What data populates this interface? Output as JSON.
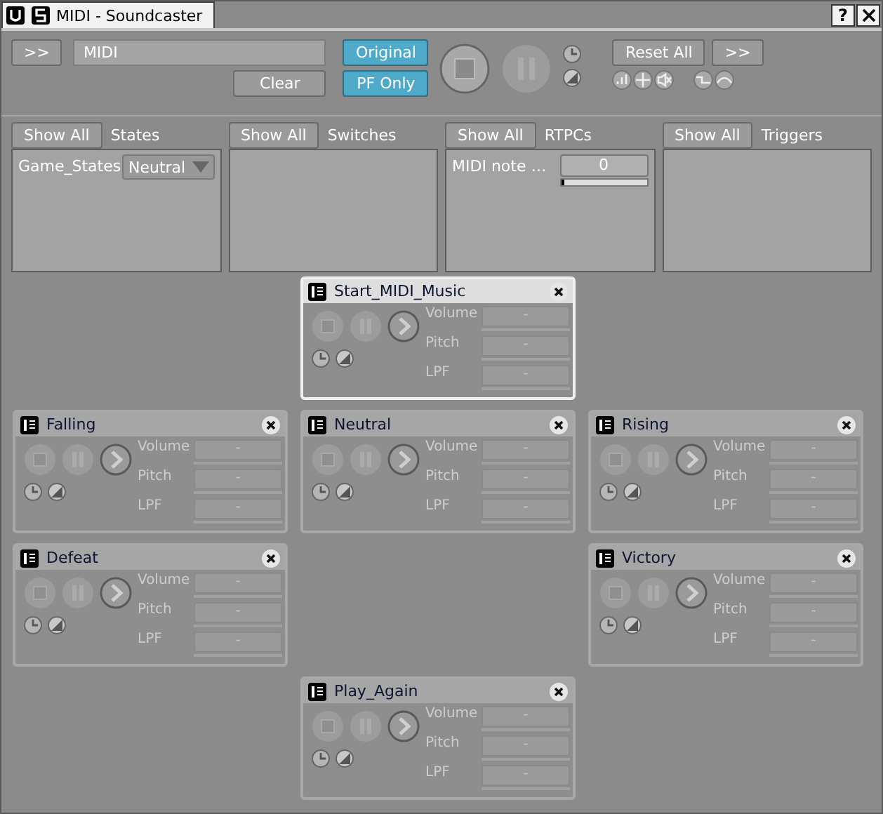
{
  "window": {
    "title": "MIDI - Soundcaster",
    "help": "?"
  },
  "toolbar": {
    "expand_left": ">>",
    "search": "MIDI",
    "clear": "Clear",
    "original": {
      "label": "Original",
      "on": true
    },
    "pf_only": {
      "label": "PF Only",
      "on": true
    },
    "reset": "Reset All",
    "expand_right": ">>"
  },
  "panels": [
    {
      "show_all": "Show All",
      "title": "States",
      "rows": [
        {
          "kind": "dropdown",
          "label": "Game_States",
          "value": "Neutral"
        }
      ]
    },
    {
      "show_all": "Show All",
      "title": "Switches"
    },
    {
      "show_all": "Show All",
      "title": "RTPCs",
      "rows": [
        {
          "kind": "slider",
          "label": "MIDI note …",
          "value": "0",
          "level": 0.02
        }
      ]
    },
    {
      "show_all": "Show All",
      "title": "Triggers"
    }
  ],
  "card_rows": [
    {
      "center": {
        "title": "Start_MIDI_Music",
        "selected": true,
        "params": [
          {
            "label": "Volume",
            "value": "-"
          },
          {
            "label": "Pitch",
            "value": "-"
          },
          {
            "label": "LPF",
            "value": "-"
          }
        ]
      }
    },
    {
      "left": {
        "title": "Falling",
        "selected": false,
        "params": [
          {
            "label": "Volume",
            "value": "-"
          },
          {
            "label": "Pitch",
            "value": "-"
          },
          {
            "label": "LPF",
            "value": "-"
          }
        ]
      },
      "center": {
        "title": "Neutral",
        "selected": false,
        "params": [
          {
            "label": "Volume",
            "value": "-"
          },
          {
            "label": "Pitch",
            "value": "-"
          },
          {
            "label": "LPF",
            "value": "-"
          }
        ]
      },
      "right": {
        "title": "Rising",
        "selected": false,
        "params": [
          {
            "label": "Volume",
            "value": "-"
          },
          {
            "label": "Pitch",
            "value": "-"
          },
          {
            "label": "LPF",
            "value": "-"
          }
        ]
      }
    },
    {
      "left": {
        "title": "Defeat",
        "selected": false,
        "params": [
          {
            "label": "Volume",
            "value": "-"
          },
          {
            "label": "Pitch",
            "value": "-"
          },
          {
            "label": "LPF",
            "value": "-"
          }
        ]
      },
      "right": {
        "title": "Victory",
        "selected": false,
        "params": [
          {
            "label": "Volume",
            "value": "-"
          },
          {
            "label": "Pitch",
            "value": "-"
          },
          {
            "label": "LPF",
            "value": "-"
          }
        ]
      }
    },
    {
      "center": {
        "title": "Play_Again",
        "selected": false,
        "params": [
          {
            "label": "Volume",
            "value": "-"
          },
          {
            "label": "Pitch",
            "value": "-"
          },
          {
            "label": "LPF",
            "value": "-"
          }
        ]
      }
    }
  ]
}
